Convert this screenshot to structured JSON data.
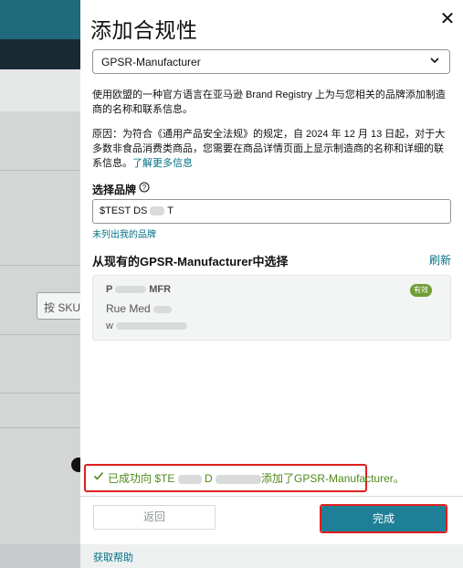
{
  "background": {
    "search_placeholder": "按 SKU、"
  },
  "panel": {
    "title": "添加合规性",
    "close_icon": "close-icon",
    "dropdown_value": "GPSR-Manufacturer",
    "description": "使用欧盟的一种官方语言在亚马逊 Brand Registry 上为与您相关的品牌添加制造商的名称和联系信息。",
    "reason_text": "原因：为符合《通用产品安全法规》的规定，自 2024 年 12 月 13 日起，对于大多数非食品消费类商品，您需要在商品详情页面上显示制造商的名称和详细的联系信息。",
    "learn_more": "了解更多信息",
    "brand_label": "选择品牌",
    "brand_value_visible": "$TEST DS",
    "brand_value_tail": "T",
    "not_listed_link": "未列出我的品牌",
    "section_heading": "从现有的GPSR-Manufacturer中选择",
    "refresh_link": "刷新",
    "card": {
      "name_prefix": "P",
      "name_suffix": "MFR",
      "address": "Rue Med",
      "contact_prefix": "w",
      "badge": "有效"
    },
    "success_prefix": "已成功向 $TE",
    "success_mid": "D",
    "success_suffix": "添加了GPSR-Manufacturer。",
    "back_button": "返回",
    "done_button": "完成",
    "help_link": "获取帮助"
  },
  "colors": {
    "accent": "#1f7f96",
    "link": "#007185",
    "success": "#4d8a1a",
    "highlight": "#e11f1f",
    "badge": "#6f9e34"
  }
}
